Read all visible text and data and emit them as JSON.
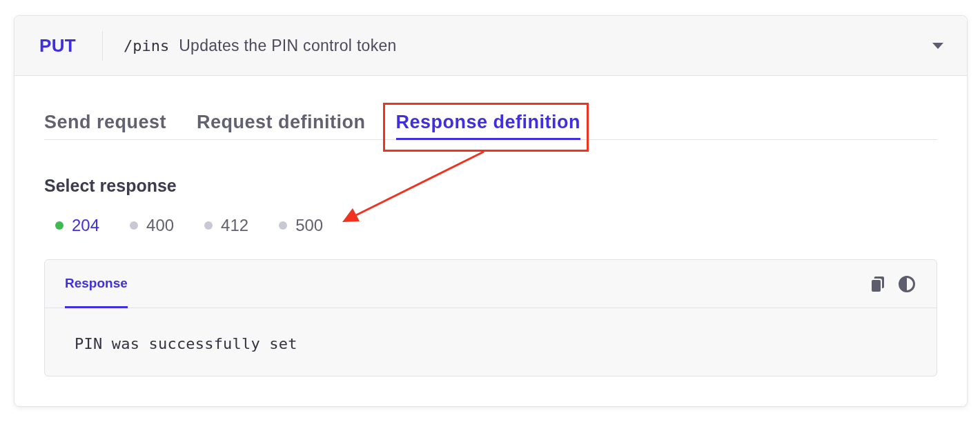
{
  "endpoint": {
    "method": "PUT",
    "path": "/pins",
    "summary": "Updates the PIN control token",
    "expanded": true
  },
  "tabs": [
    {
      "label": "Send request",
      "selected": false
    },
    {
      "label": "Request definition",
      "selected": false
    },
    {
      "label": "Response definition",
      "selected": true
    }
  ],
  "response_selector": {
    "title": "Select response",
    "options": [
      {
        "code": "204",
        "selected": true
      },
      {
        "code": "400",
        "selected": false
      },
      {
        "code": "412",
        "selected": false
      },
      {
        "code": "500",
        "selected": false
      }
    ]
  },
  "response_panel": {
    "tabs": [
      {
        "label": "Response",
        "selected": true
      }
    ],
    "body": "PIN was successfully set"
  },
  "callouts": {
    "highlight_box": true,
    "arrow": true
  }
}
